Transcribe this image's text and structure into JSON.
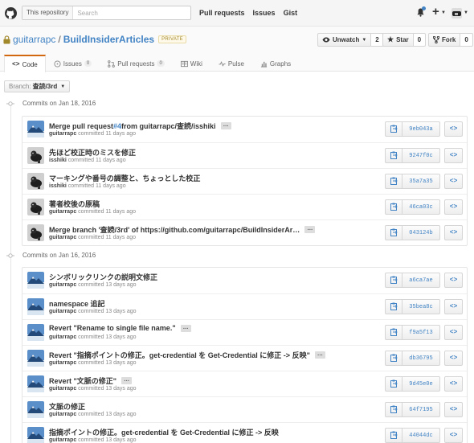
{
  "header": {
    "search_scope": "This repository",
    "search_placeholder": "Search",
    "nav": [
      "Pull requests",
      "Issues",
      "Gist"
    ]
  },
  "repo": {
    "owner": "guitarrapc",
    "separator": "/",
    "name": "BuildInsiderArticles",
    "badge": "PRIVATE",
    "actions": {
      "watch_label": "Unwatch",
      "watch_count": "2",
      "star_label": "Star",
      "star_count": "0",
      "fork_label": "Fork",
      "fork_count": "0"
    },
    "tabs": [
      {
        "label": "Code",
        "count": "",
        "icon": "code-icon"
      },
      {
        "label": "Issues",
        "count": "0",
        "icon": "issue-icon"
      },
      {
        "label": "Pull requests",
        "count": "0",
        "icon": "pull-request-icon"
      },
      {
        "label": "Wiki",
        "count": "",
        "icon": "book-icon"
      },
      {
        "label": "Pulse",
        "count": "",
        "icon": "pulse-icon"
      },
      {
        "label": "Graphs",
        "count": "",
        "icon": "graph-icon"
      }
    ]
  },
  "branch": {
    "label": "Branch:",
    "value": "査読/3rd"
  },
  "groups": [
    {
      "heading": "Commits on Jan 18, 2016",
      "commits": [
        {
          "message_prefix": "Merge pull request ",
          "message_link": "#4",
          "message_suffix": " from guitarrapc/査読/isshiki",
          "has_more": true,
          "author": "guitarrapc",
          "time": "committed 11 days ago",
          "sha": "9eb043a",
          "avatar": "mountain"
        },
        {
          "message_prefix": "先ほど校正時のミスを修正",
          "message_link": "",
          "message_suffix": "",
          "has_more": false,
          "author": "isshiki",
          "time": "committed 11 days ago",
          "sha": "9247f0c",
          "avatar": "dog"
        },
        {
          "message_prefix": "マーキングや番号の調整と、ちょっとした校正",
          "message_link": "",
          "message_suffix": "",
          "has_more": false,
          "author": "isshiki",
          "time": "committed 11 days ago",
          "sha": "35a7a35",
          "avatar": "dog"
        },
        {
          "message_prefix": "著者校後の原稿",
          "message_link": "",
          "message_suffix": "",
          "has_more": false,
          "author": "guitarrapc",
          "time": "committed 11 days ago",
          "sha": "46ca03c",
          "avatar": "dog"
        },
        {
          "message_prefix": "Merge branch '査読/3rd' of https://github.com/guitarrapc/BuildInsiderAr…",
          "message_link": "",
          "message_suffix": "",
          "has_more": true,
          "author": "guitarrapc",
          "time": "committed 11 days ago",
          "sha": "043124b",
          "avatar": "dog"
        }
      ]
    },
    {
      "heading": "Commits on Jan 16, 2016",
      "commits": [
        {
          "message_prefix": "シンボリックリンクの説明文修正",
          "message_link": "",
          "message_suffix": "",
          "has_more": false,
          "author": "guitarrapc",
          "time": "committed 13 days ago",
          "sha": "a6ca7ae",
          "avatar": "mountain"
        },
        {
          "message_prefix": "namespace 追記",
          "message_link": "",
          "message_suffix": "",
          "has_more": false,
          "author": "guitarrapc",
          "time": "committed 13 days ago",
          "sha": "35bea8c",
          "avatar": "mountain"
        },
        {
          "message_prefix": "Revert \"Rename to single file name.\"",
          "message_link": "",
          "message_suffix": "",
          "has_more": true,
          "author": "guitarrapc",
          "time": "committed 13 days ago",
          "sha": "f9a5f13",
          "avatar": "mountain"
        },
        {
          "message_prefix": "Revert \"指摘ポイントの修正。get-credential を Get-Credential に修正 -> 反映\"",
          "message_link": "",
          "message_suffix": "",
          "has_more": true,
          "author": "guitarrapc",
          "time": "committed 13 days ago",
          "sha": "db36795",
          "avatar": "mountain"
        },
        {
          "message_prefix": "Revert \"文脈の修正\"",
          "message_link": "",
          "message_suffix": "",
          "has_more": true,
          "author": "guitarrapc",
          "time": "committed 13 days ago",
          "sha": "9d45e0e",
          "avatar": "mountain"
        },
        {
          "message_prefix": "文脈の修正",
          "message_link": "",
          "message_suffix": "",
          "has_more": false,
          "author": "guitarrapc",
          "time": "committed 13 days ago",
          "sha": "64f7195",
          "avatar": "mountain"
        },
        {
          "message_prefix": "指摘ポイントの修正。get-credential を Get-Credential に修正 -> 反映",
          "message_link": "",
          "message_suffix": "",
          "has_more": false,
          "author": "guitarrapc",
          "time": "committed 13 days ago",
          "sha": "44044dc",
          "avatar": "mountain"
        }
      ]
    }
  ],
  "more_glyph": "…",
  "browse_glyph": "<>"
}
